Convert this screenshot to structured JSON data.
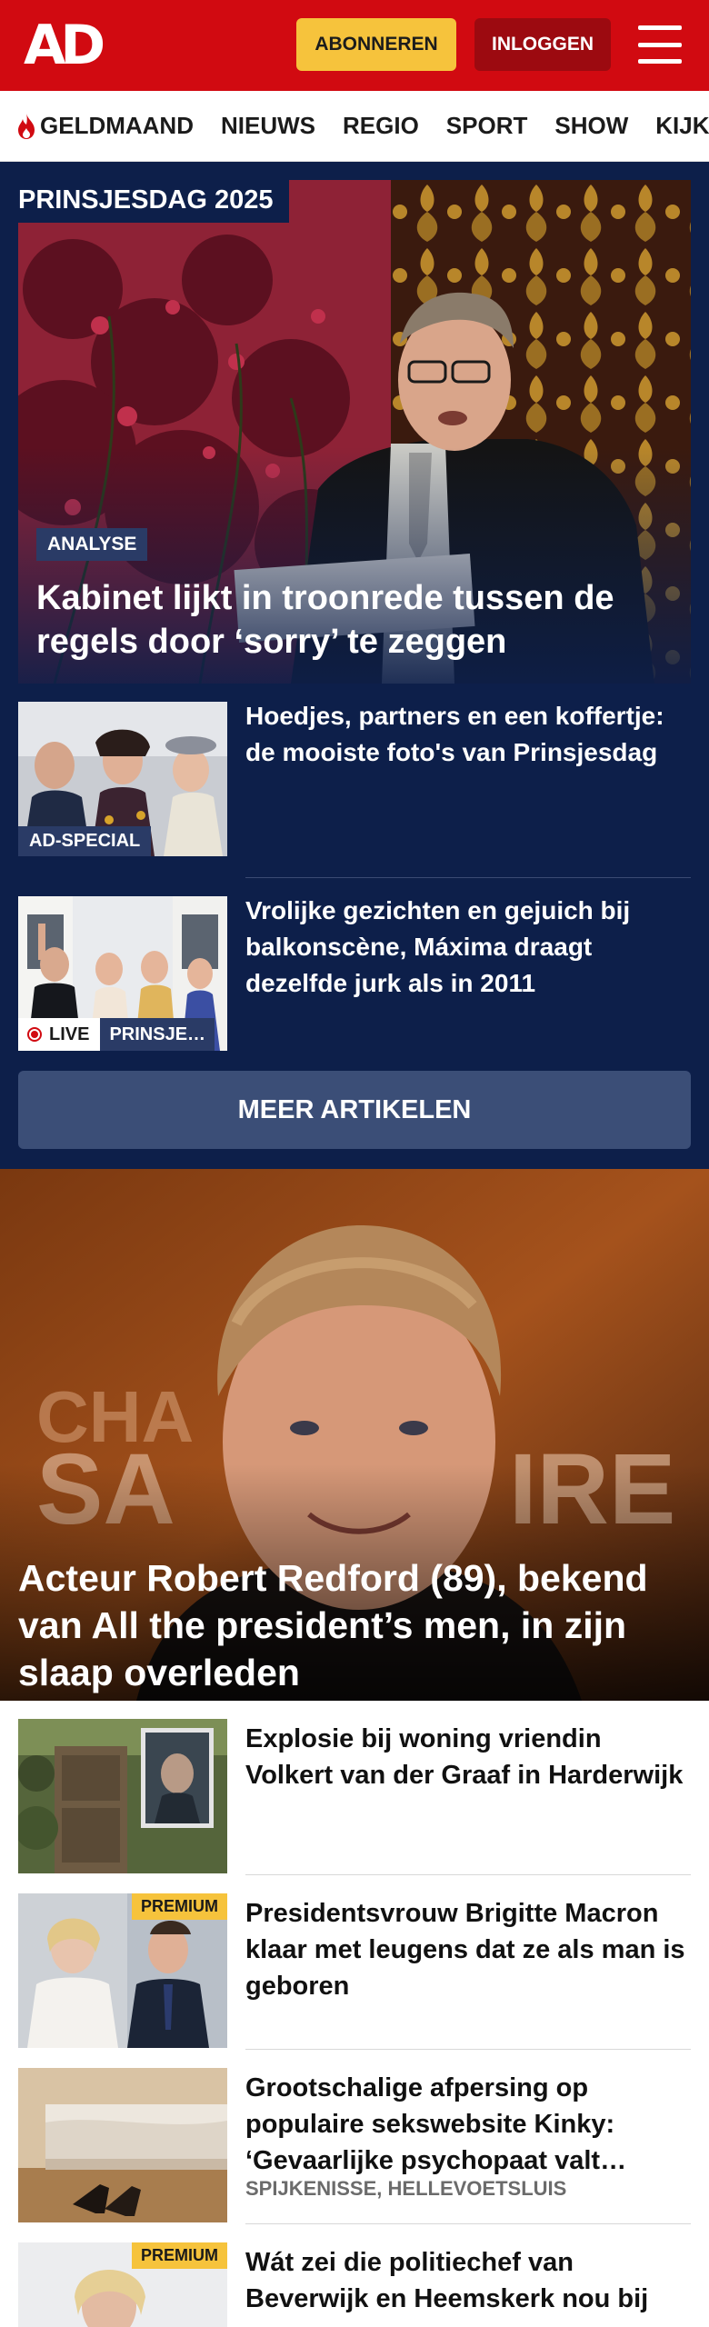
{
  "header": {
    "logo": "AD",
    "subscribe_label": "ABONNEREN",
    "login_label": "INLOGGEN",
    "menu_icon": "hamburger-menu-icon",
    "brand_color": "#d10a11"
  },
  "nav": {
    "items": [
      {
        "label": "GELDMAAND",
        "icon": "flame-icon"
      },
      {
        "label": "NIEUWS"
      },
      {
        "label": "REGIO"
      },
      {
        "label": "SPORT"
      },
      {
        "label": "SHOW"
      },
      {
        "label": "KIJK"
      }
    ]
  },
  "prinsjesdag": {
    "section_label": "PRINSJESDAG 2025",
    "hero": {
      "tag": "ANALYSE",
      "title": "Kabinet lijkt in troonrede tussen de regels door ‘sorry’ te zeggen"
    },
    "articles": [
      {
        "title": "Hoedjes, partners en een koffertje: de mooiste foto's van Prinsjesdag",
        "badge": "AD-SPECIAL"
      },
      {
        "title": "Vrolijke gezichten en gejuich bij balkonscène, Máxima draagt dezelfde jurk als in 2011",
        "live_label": "LIVE",
        "topic": "PRINSJE…"
      }
    ],
    "more_label": "MEER ARTIKELEN",
    "bg_color": "#0d1f4a"
  },
  "feature": {
    "title": "Acteur Robert Redford (89), bekend van All the president’s men, in zijn slaap overleden"
  },
  "list": [
    {
      "title": "Explosie bij woning vriendin Volkert van der Graaf in Harderwijk"
    },
    {
      "title": "Presidentsvrouw Brigitte Macron klaar met leugens dat ze als man is geboren",
      "badge": "PREMIUM"
    },
    {
      "title": "Grootschalige afpersing op populaire sekswebsite Kinky: ‘Gevaarlijke psychopaat valt…",
      "meta": "SPIJKENISSE, HELLEVOETSLUIS"
    },
    {
      "title": "Wát zei die politiechef van Beverwijk en Heemskerk nou bij",
      "badge": "PREMIUM"
    }
  ]
}
